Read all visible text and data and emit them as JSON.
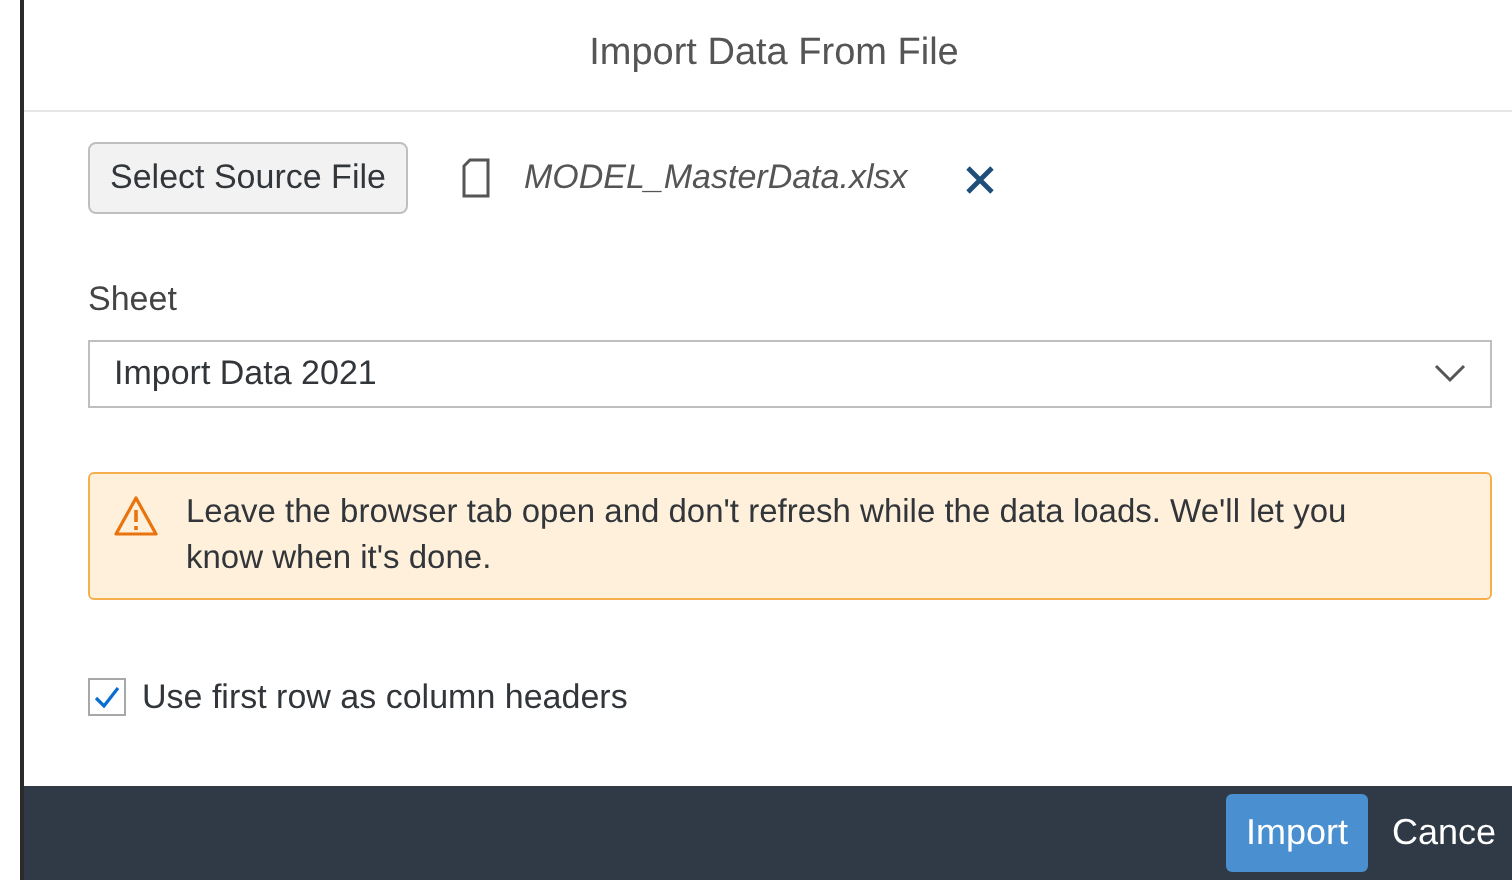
{
  "dialog": {
    "title": "Import Data From File"
  },
  "source": {
    "button": "Select Source File",
    "file_name": "MODEL_MasterData.xlsx"
  },
  "sheet": {
    "label": "Sheet",
    "value": "Import Data 2021"
  },
  "warning": {
    "text": "Leave the browser tab open and don't refresh while the data loads. We'll let you know when it's done."
  },
  "options": [
    {
      "label": "Use first row as column headers",
      "checked": true
    }
  ],
  "footer_buttons": [
    {
      "label": "Import",
      "kind": "primary"
    },
    {
      "label": "Cance",
      "kind": "plain"
    }
  ]
}
